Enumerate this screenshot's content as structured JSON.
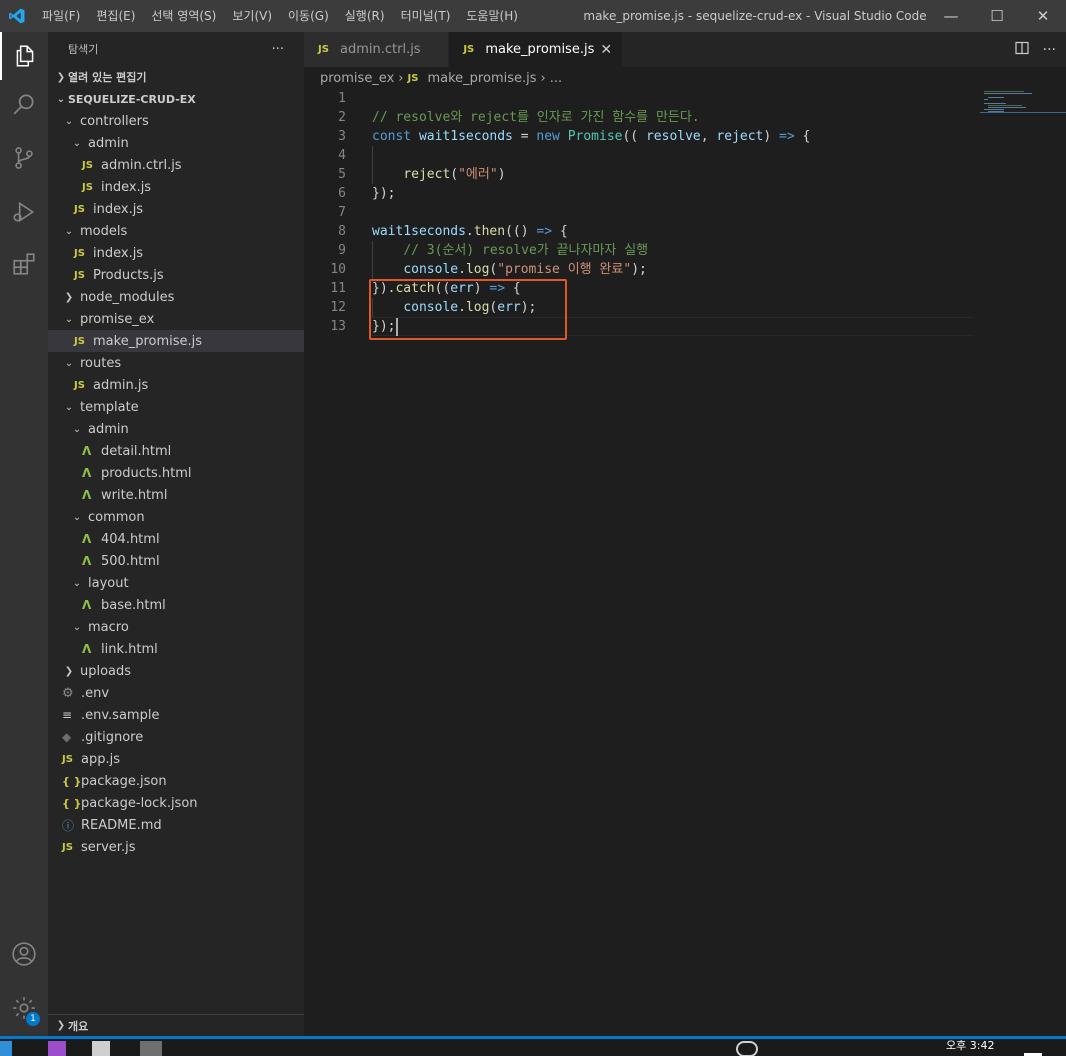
{
  "titlebar": {
    "menus": [
      "파일(F)",
      "편집(E)",
      "선택 영역(S)",
      "보기(V)",
      "이동(G)",
      "실행(R)",
      "터미널(T)",
      "도움말(H)"
    ],
    "window_title": "make_promise.js - sequelize-crud-ex - Visual Studio Code",
    "controls": [
      "—",
      "☐",
      "✕"
    ]
  },
  "activitybar": {
    "icons": [
      "explorer-icon",
      "search-icon",
      "source-control-icon",
      "run-debug-icon",
      "extensions-icon",
      "account-icon",
      "manage-gear-icon"
    ],
    "manage_badge": "1"
  },
  "sidebar": {
    "title": "탐색기",
    "more": "···",
    "open_editors_label": "열려 있는 편집기",
    "project_label": "SEQUELIZE-CRUD-EX",
    "outline_label": "개요",
    "tree": [
      {
        "label": "controllers",
        "kind": "folder-open",
        "depth": 1
      },
      {
        "label": "admin",
        "kind": "folder-open",
        "depth": 2
      },
      {
        "label": "admin.ctrl.js",
        "kind": "js",
        "depth": 3
      },
      {
        "label": "index.js",
        "kind": "js",
        "depth": 3
      },
      {
        "label": "index.js",
        "kind": "js",
        "depth": 2
      },
      {
        "label": "models",
        "kind": "folder-open",
        "depth": 1
      },
      {
        "label": "index.js",
        "kind": "js",
        "depth": 2
      },
      {
        "label": "Products.js",
        "kind": "js",
        "depth": 2
      },
      {
        "label": "node_modules",
        "kind": "folder-closed",
        "depth": 1
      },
      {
        "label": "promise_ex",
        "kind": "folder-open",
        "depth": 1
      },
      {
        "label": "make_promise.js",
        "kind": "js",
        "depth": 2,
        "selected": true
      },
      {
        "label": "routes",
        "kind": "folder-open",
        "depth": 1
      },
      {
        "label": "admin.js",
        "kind": "js",
        "depth": 2
      },
      {
        "label": "template",
        "kind": "folder-open",
        "depth": 1
      },
      {
        "label": "admin",
        "kind": "folder-open",
        "depth": 2
      },
      {
        "label": "detail.html",
        "kind": "njk",
        "depth": 3
      },
      {
        "label": "products.html",
        "kind": "njk",
        "depth": 3
      },
      {
        "label": "write.html",
        "kind": "njk",
        "depth": 3
      },
      {
        "label": "common",
        "kind": "folder-open",
        "depth": 2
      },
      {
        "label": "404.html",
        "kind": "njk",
        "depth": 3
      },
      {
        "label": "500.html",
        "kind": "njk",
        "depth": 3
      },
      {
        "label": "layout",
        "kind": "folder-open",
        "depth": 2
      },
      {
        "label": "base.html",
        "kind": "njk",
        "depth": 3
      },
      {
        "label": "macro",
        "kind": "folder-open",
        "depth": 2
      },
      {
        "label": "link.html",
        "kind": "njk",
        "depth": 3
      },
      {
        "label": "uploads",
        "kind": "folder-closed",
        "depth": 1
      },
      {
        "label": ".env",
        "kind": "gear",
        "depth": 1
      },
      {
        "label": ".env.sample",
        "kind": "lines",
        "depth": 1
      },
      {
        "label": ".gitignore",
        "kind": "git",
        "depth": 1
      },
      {
        "label": "app.js",
        "kind": "js",
        "depth": 1
      },
      {
        "label": "package.json",
        "kind": "json",
        "depth": 1
      },
      {
        "label": "package-lock.json",
        "kind": "json",
        "depth": 1
      },
      {
        "label": "README.md",
        "kind": "info",
        "depth": 1
      },
      {
        "label": "server.js",
        "kind": "js",
        "depth": 1
      }
    ]
  },
  "tabs": [
    {
      "label": "admin.ctrl.js",
      "icon": "JS",
      "active": false
    },
    {
      "label": "make_promise.js",
      "icon": "JS",
      "active": true,
      "close": "✕"
    }
  ],
  "tab_actions": [
    "split-editor-icon",
    "more-actions-icon"
  ],
  "breadcrumb": {
    "folder": "promise_ex",
    "icon": "JS",
    "file": "make_promise.js",
    "more": "..."
  },
  "editor": {
    "lines": [
      {
        "n": "1",
        "tokens": []
      },
      {
        "n": "2",
        "tokens": [
          [
            "c-comment",
            "// resolve와 reject를 인자로 가진 함수를 만든다."
          ]
        ]
      },
      {
        "n": "3",
        "tokens": [
          [
            "c-kw",
            "const"
          ],
          [
            "c-plain",
            " "
          ],
          [
            "c-var",
            "wait1seconds"
          ],
          [
            "c-plain",
            " = "
          ],
          [
            "c-kw",
            "new"
          ],
          [
            "c-plain",
            " "
          ],
          [
            "c-cls",
            "Promise"
          ],
          [
            "c-plain",
            "(( "
          ],
          [
            "c-var",
            "resolve"
          ],
          [
            "c-plain",
            ", "
          ],
          [
            "c-var",
            "reject"
          ],
          [
            "c-plain",
            ") "
          ],
          [
            "c-kw",
            "=>"
          ],
          [
            "c-plain",
            " {"
          ]
        ]
      },
      {
        "n": "4",
        "tokens": []
      },
      {
        "n": "5",
        "tokens": [
          [
            "c-plain",
            "    "
          ],
          [
            "c-fn",
            "reject"
          ],
          [
            "c-plain",
            "("
          ],
          [
            "c-str",
            "\"에러\""
          ],
          [
            "c-plain",
            ")"
          ]
        ]
      },
      {
        "n": "6",
        "tokens": [
          [
            "c-plain",
            "});"
          ]
        ]
      },
      {
        "n": "7",
        "tokens": []
      },
      {
        "n": "8",
        "tokens": [
          [
            "c-var",
            "wait1seconds"
          ],
          [
            "c-plain",
            "."
          ],
          [
            "c-fn",
            "then"
          ],
          [
            "c-plain",
            "(() "
          ],
          [
            "c-kw",
            "=>"
          ],
          [
            "c-plain",
            " {"
          ]
        ]
      },
      {
        "n": "9",
        "tokens": [
          [
            "c-plain",
            "    "
          ],
          [
            "c-comment",
            "// 3(순서) resolve가 끝나자마자 실행"
          ]
        ]
      },
      {
        "n": "10",
        "tokens": [
          [
            "c-plain",
            "    "
          ],
          [
            "c-var",
            "console"
          ],
          [
            "c-plain",
            "."
          ],
          [
            "c-fn",
            "log"
          ],
          [
            "c-plain",
            "("
          ],
          [
            "c-str",
            "\"promise 이행 완료\""
          ],
          [
            "c-plain",
            ");"
          ]
        ]
      },
      {
        "n": "11",
        "tokens": [
          [
            "c-plain",
            "})."
          ],
          [
            "c-fn",
            "catch"
          ],
          [
            "c-plain",
            "(("
          ],
          [
            "c-var",
            "err"
          ],
          [
            "c-plain",
            ") "
          ],
          [
            "c-kw",
            "=>"
          ],
          [
            "c-plain",
            " {"
          ]
        ]
      },
      {
        "n": "12",
        "tokens": [
          [
            "c-plain",
            "    "
          ],
          [
            "c-var",
            "console"
          ],
          [
            "c-plain",
            "."
          ],
          [
            "c-fn",
            "log"
          ],
          [
            "c-plain",
            "("
          ],
          [
            "c-var",
            "err"
          ],
          [
            "c-plain",
            ");"
          ]
        ]
      },
      {
        "n": "13",
        "tokens": [
          [
            "c-plain",
            "});"
          ]
        ]
      }
    ]
  },
  "taskbar": {
    "clock": "오후 3:42"
  },
  "colors": {
    "accent": "#007acc",
    "highlight_box": "#e0572a",
    "js_icon": "#cbcb41",
    "html_icon": "#8dc149"
  }
}
